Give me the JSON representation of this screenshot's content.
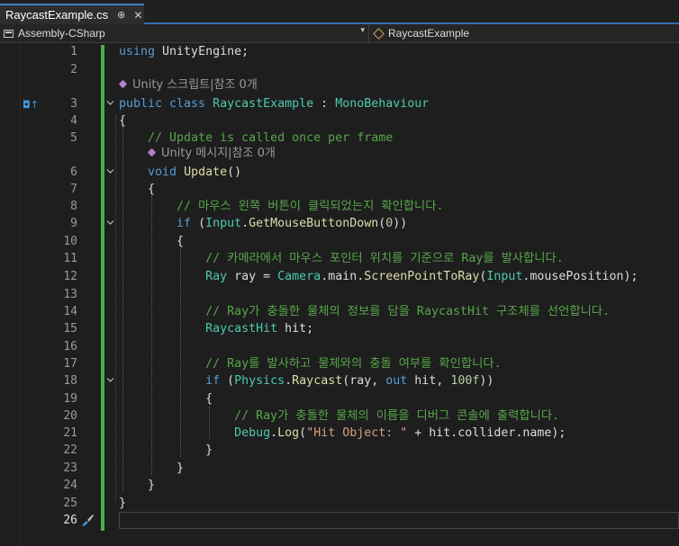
{
  "tab": {
    "title": "RaycastExample.cs",
    "pin": "⊕",
    "close": "✕"
  },
  "navbar": {
    "project": "Assembly-CSharp",
    "class_name": "RaycastExample",
    "dropdown": "▾"
  },
  "lens": {
    "class": "Unity 스크립트|참조 0개",
    "method": "Unity 메시지|참조 0개"
  },
  "gutter_marker": "◘↑",
  "lines": [
    {
      "n": "1",
      "tokens": [
        [
          "kw",
          "using"
        ],
        [
          "pl",
          " UnityEngine;"
        ]
      ]
    },
    {
      "n": "2",
      "tokens": []
    },
    {
      "n": "3",
      "tokens": [
        [
          "kw",
          "public class "
        ],
        [
          "ty",
          "RaycastExample"
        ],
        [
          "pl",
          " : "
        ],
        [
          "ty",
          "MonoBehaviour"
        ]
      ]
    },
    {
      "n": "4",
      "tokens": [
        [
          "pl",
          "{"
        ]
      ]
    },
    {
      "n": "5",
      "tokens": [
        [
          "pl",
          "    "
        ],
        [
          "cm",
          "// Update is called once per frame"
        ]
      ]
    },
    {
      "n": "6",
      "tokens": [
        [
          "pl",
          "    "
        ],
        [
          "kw",
          "void"
        ],
        [
          "pl",
          " "
        ],
        [
          "mt",
          "Update"
        ],
        [
          "pl",
          "()"
        ]
      ]
    },
    {
      "n": "7",
      "tokens": [
        [
          "pl",
          "    {"
        ]
      ]
    },
    {
      "n": "8",
      "tokens": [
        [
          "pl",
          "        "
        ],
        [
          "cm",
          "// 마우스 왼쪽 버튼이 클릭되었는지 확인합니다."
        ]
      ]
    },
    {
      "n": "9",
      "tokens": [
        [
          "pl",
          "        "
        ],
        [
          "kw",
          "if"
        ],
        [
          "pl",
          " ("
        ],
        [
          "ty",
          "Input"
        ],
        [
          "pl",
          "."
        ],
        [
          "mt",
          "GetMouseButtonDown"
        ],
        [
          "pl",
          "("
        ],
        [
          "nm",
          "0"
        ],
        [
          "pl",
          "))"
        ]
      ]
    },
    {
      "n": "10",
      "tokens": [
        [
          "pl",
          "        {"
        ]
      ]
    },
    {
      "n": "11",
      "tokens": [
        [
          "pl",
          "            "
        ],
        [
          "cm",
          "// 카메라에서 마우스 포인터 위치를 기준으로 Ray를 발사합니다."
        ]
      ]
    },
    {
      "n": "12",
      "tokens": [
        [
          "pl",
          "            "
        ],
        [
          "ty",
          "Ray"
        ],
        [
          "pl",
          " ray = "
        ],
        [
          "ty",
          "Camera"
        ],
        [
          "pl",
          ".main."
        ],
        [
          "mt",
          "ScreenPointToRay"
        ],
        [
          "pl",
          "("
        ],
        [
          "ty",
          "Input"
        ],
        [
          "pl",
          ".mousePosition);"
        ]
      ]
    },
    {
      "n": "13",
      "tokens": []
    },
    {
      "n": "14",
      "tokens": [
        [
          "pl",
          "            "
        ],
        [
          "cm",
          "// Ray가 충돌한 물체의 정보를 담을 RaycastHit 구조체를 선언합니다."
        ]
      ]
    },
    {
      "n": "15",
      "tokens": [
        [
          "pl",
          "            "
        ],
        [
          "ty",
          "RaycastHit"
        ],
        [
          "pl",
          " hit;"
        ]
      ]
    },
    {
      "n": "16",
      "tokens": []
    },
    {
      "n": "17",
      "tokens": [
        [
          "pl",
          "            "
        ],
        [
          "cm",
          "// Ray를 발사하고 물체와의 충돌 여부를 확인합니다."
        ]
      ]
    },
    {
      "n": "18",
      "tokens": [
        [
          "pl",
          "            "
        ],
        [
          "kw",
          "if"
        ],
        [
          "pl",
          " ("
        ],
        [
          "ty",
          "Physics"
        ],
        [
          "pl",
          "."
        ],
        [
          "mt",
          "Raycast"
        ],
        [
          "pl",
          "(ray, "
        ],
        [
          "kw",
          "out"
        ],
        [
          "pl",
          " hit, "
        ],
        [
          "nm",
          "100f"
        ],
        [
          "pl",
          "))"
        ]
      ]
    },
    {
      "n": "19",
      "tokens": [
        [
          "pl",
          "            {"
        ]
      ]
    },
    {
      "n": "20",
      "tokens": [
        [
          "pl",
          "                "
        ],
        [
          "cm",
          "// Ray가 충돌한 물체의 이름을 디버그 콘솔에 출력합니다."
        ]
      ]
    },
    {
      "n": "21",
      "tokens": [
        [
          "pl",
          "                "
        ],
        [
          "ty",
          "Debug"
        ],
        [
          "pl",
          "."
        ],
        [
          "mt",
          "Log"
        ],
        [
          "pl",
          "("
        ],
        [
          "st",
          "\"Hit Object: \""
        ],
        [
          "pl",
          " + hit.collider.name);"
        ]
      ]
    },
    {
      "n": "22",
      "tokens": [
        [
          "pl",
          "            }"
        ]
      ]
    },
    {
      "n": "23",
      "tokens": [
        [
          "pl",
          "        }"
        ]
      ]
    },
    {
      "n": "24",
      "tokens": [
        [
          "pl",
          "    }"
        ]
      ]
    },
    {
      "n": "25",
      "tokens": [
        [
          "pl",
          "}"
        ]
      ]
    },
    {
      "n": "26",
      "tokens": []
    }
  ]
}
